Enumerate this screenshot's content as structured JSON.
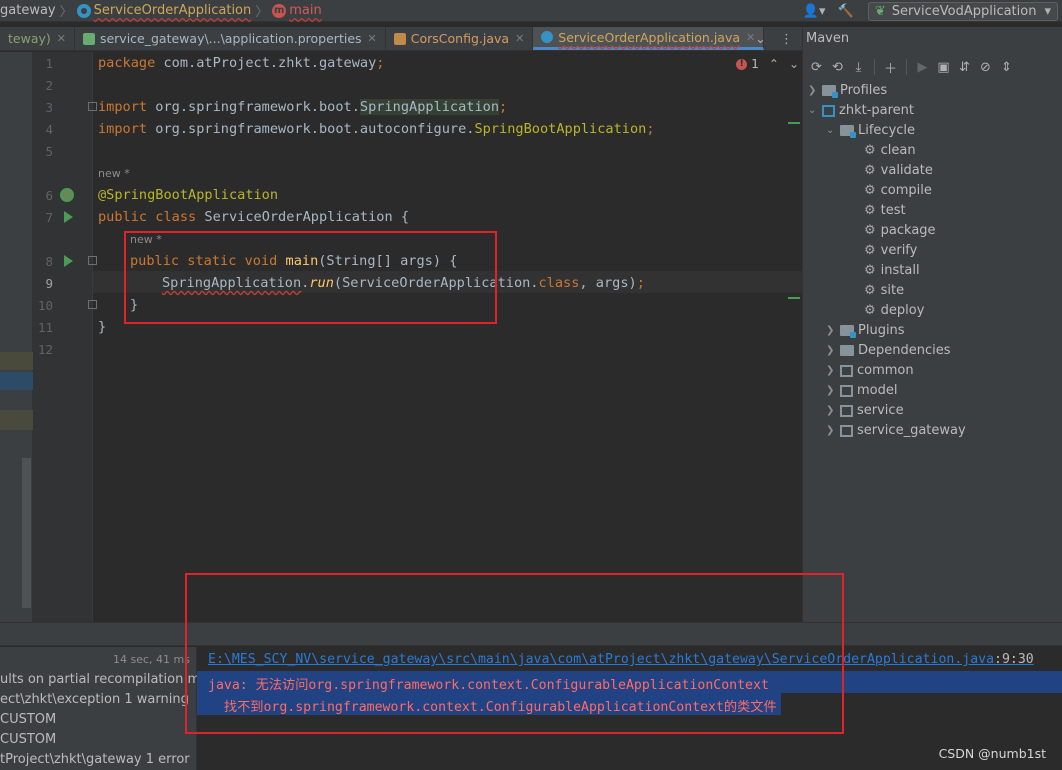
{
  "navbar": {
    "crumbs": [
      "gateway",
      "ServiceOrderApplication",
      "main"
    ],
    "run_config": "ServiceVodApplication"
  },
  "tabs": [
    {
      "label": "teway)"
    },
    {
      "label": "service_gateway\\...\\application.properties"
    },
    {
      "label": "CorsConfig.java"
    },
    {
      "label": "ServiceOrderApplication.java"
    }
  ],
  "editor": {
    "error_count": "1",
    "line_numbers": [
      "1",
      "2",
      "3",
      "4",
      "5",
      "6",
      "7",
      "8",
      "9",
      "10",
      "11",
      "12"
    ],
    "hints": [
      "new *",
      "new *"
    ],
    "code": {
      "l1_kw": "package",
      "l1_rest": " com.atProject.zhkt.gateway",
      "l1_semi": ";",
      "l3_kw": "import",
      "l3_pkg": " org.springframework.boot.",
      "l3_cls": "SpringApplication",
      "l3_semi": ";",
      "l4_kw": "import",
      "l4_pkg": " org.springframework.boot.autoconfigure.",
      "l4_cls": "SpringBootApplication",
      "l4_semi": ";",
      "l6_ann": "@SpringBootApplication",
      "l7_kw": "public class",
      "l7_name": " ServiceOrderApplication ",
      "l7_brace": "{",
      "l8_kw": "public static void",
      "l8_fn": " main",
      "l8_rest": "(String[] args) {",
      "l9_cls": "SpringApplication",
      "l9_dot": ".",
      "l9_run": "run",
      "l9_args1": "(ServiceOrderApplication.",
      "l9_kwclass": "class",
      "l9_args2": ", args)",
      "l9_semi": ";",
      "l10": "}",
      "l11": "}"
    }
  },
  "maven": {
    "title": "Maven",
    "tree": [
      {
        "label": "Profiles"
      },
      {
        "label": "zhkt-parent"
      },
      {
        "label": "Lifecycle"
      },
      {
        "label": "clean"
      },
      {
        "label": "validate"
      },
      {
        "label": "compile"
      },
      {
        "label": "test"
      },
      {
        "label": "package"
      },
      {
        "label": "verify"
      },
      {
        "label": "install"
      },
      {
        "label": "site"
      },
      {
        "label": "deploy"
      },
      {
        "label": "Plugins"
      },
      {
        "label": "Dependencies"
      },
      {
        "label": "common"
      },
      {
        "label": "model"
      },
      {
        "label": "service"
      },
      {
        "label": "service_gateway"
      }
    ]
  },
  "build": {
    "time": "14 sec, 41 ms",
    "left_lines": [
      "ults on partial recompilation may",
      "ect\\zhkt\\exception 1 warning",
      "CUSTOM",
      "CUSTOM",
      "tProject\\zhkt\\gateway 1 error"
    ],
    "output": {
      "path": "E:\\MES_SCY_NV\\service_gateway\\src\\main\\java\\com\\atProject\\zhkt\\gateway\\ServiceOrderApplication.java",
      "position": ":9:30",
      "error1": "java: 无法访问org.springframework.context.ConfigurableApplicationContext",
      "error2": "  找不到org.springframework.context.ConfigurableApplicationContext的类文件"
    }
  },
  "watermark": "CSDN @numb1st"
}
